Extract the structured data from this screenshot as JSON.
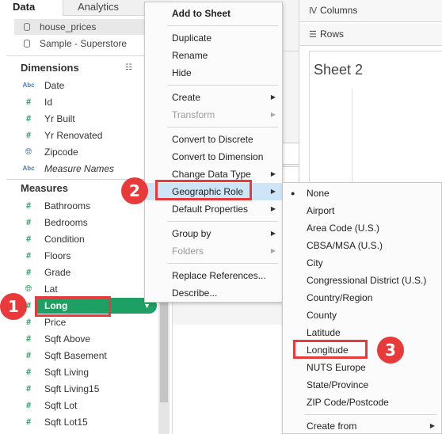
{
  "tabs": {
    "data": "Data",
    "analytics": "Analytics"
  },
  "datasources": [
    "house_prices",
    "Sample - Superstore"
  ],
  "dimensions": {
    "title": "Dimensions",
    "items": [
      {
        "label": "Date",
        "icon": "abc-icon"
      },
      {
        "label": "Id",
        "icon": "number-icon"
      },
      {
        "label": "Yr Built",
        "icon": "number-icon"
      },
      {
        "label": "Yr Renovated",
        "icon": "number-icon"
      },
      {
        "label": "Zipcode",
        "icon": "globe-icon"
      },
      {
        "label": "Measure Names",
        "icon": "abc-icon"
      }
    ]
  },
  "measures": {
    "title": "Measures",
    "items": [
      {
        "label": "Bathrooms"
      },
      {
        "label": "Bedrooms"
      },
      {
        "label": "Condition"
      },
      {
        "label": "Floors"
      },
      {
        "label": "Grade"
      },
      {
        "label": "Lat"
      },
      {
        "label": "Long"
      },
      {
        "label": "Price"
      },
      {
        "label": "Sqft Above"
      },
      {
        "label": "Sqft Basement"
      },
      {
        "label": "Sqft Living"
      },
      {
        "label": "Sqft Living15"
      },
      {
        "label": "Sqft Lot"
      },
      {
        "label": "Sqft Lot15"
      }
    ]
  },
  "shelves": {
    "columns": "Columns",
    "rows": "Rows"
  },
  "sheet": {
    "title": "Sheet 2"
  },
  "context_menu": {
    "items": [
      {
        "label": "Add to Sheet"
      },
      {
        "label": "Duplicate"
      },
      {
        "label": "Rename"
      },
      {
        "label": "Hide"
      },
      {
        "label": "Create"
      },
      {
        "label": "Transform"
      },
      {
        "label": "Convert to Discrete"
      },
      {
        "label": "Convert to Dimension"
      },
      {
        "label": "Change Data Type"
      },
      {
        "label": "Geographic Role"
      },
      {
        "label": "Default Properties"
      },
      {
        "label": "Group by"
      },
      {
        "label": "Folders"
      },
      {
        "label": "Replace References..."
      },
      {
        "label": "Describe..."
      }
    ]
  },
  "geo_menu": {
    "items": [
      {
        "label": "None"
      },
      {
        "label": "Airport"
      },
      {
        "label": "Area Code (U.S.)"
      },
      {
        "label": "CBSA/MSA (U.S.)"
      },
      {
        "label": "City"
      },
      {
        "label": "Congressional District (U.S.)"
      },
      {
        "label": "Country/Region"
      },
      {
        "label": "County"
      },
      {
        "label": "Latitude"
      },
      {
        "label": "Longitude"
      },
      {
        "label": "NUTS Europe"
      },
      {
        "label": "State/Province"
      },
      {
        "label": "ZIP Code/Postcode"
      },
      {
        "label": "Create from"
      }
    ]
  },
  "callouts": [
    "1",
    "2",
    "3"
  ],
  "colors": {
    "pill": "#1ea064",
    "callout": "#e83a3a",
    "abc": "#4a7fb5",
    "measure": "#16a056"
  }
}
